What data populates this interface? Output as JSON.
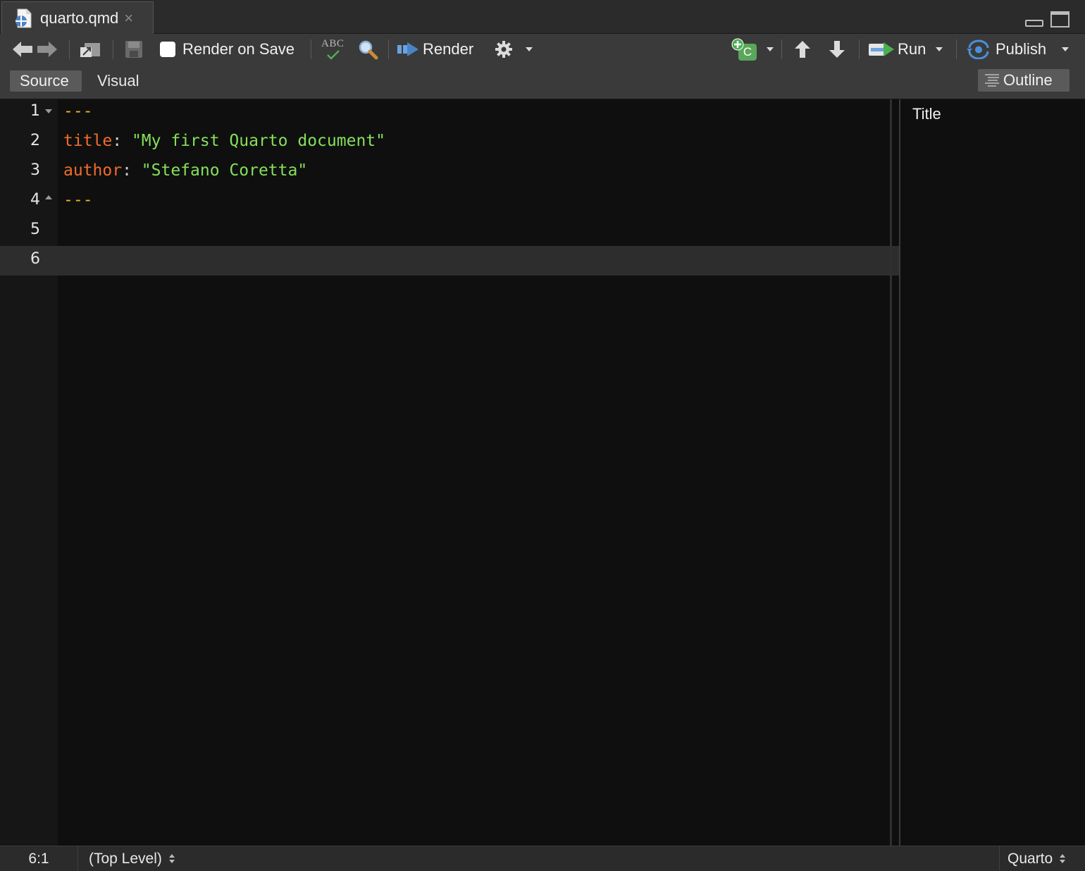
{
  "tab": {
    "filename": "quarto.qmd",
    "close_glyph": "×",
    "icon": "quarto-file-icon"
  },
  "toolbar": {
    "render_on_save_label": "Render on Save",
    "render_on_save_checked": false,
    "spellcheck_label": "ABC",
    "render_label": "Render",
    "run_label": "Run",
    "publish_label": "Publish",
    "insert_chunk_letter": "C"
  },
  "modes": {
    "source_label": "Source",
    "visual_label": "Visual",
    "active": "source"
  },
  "outline_button_label": "Outline",
  "editor": {
    "lines": [
      {
        "num": "1",
        "fold": "down",
        "tokens": [
          {
            "t": "---",
            "c": "yaml-delim"
          }
        ]
      },
      {
        "num": "2",
        "tokens": [
          {
            "t": "title",
            "c": "yaml-key"
          },
          {
            "t": ": ",
            "c": "yaml-colon"
          },
          {
            "t": "\"My first Quarto document\"",
            "c": "yaml-str"
          }
        ]
      },
      {
        "num": "3",
        "tokens": [
          {
            "t": "author",
            "c": "yaml-key"
          },
          {
            "t": ": ",
            "c": "yaml-colon"
          },
          {
            "t": "\"Stefano Coretta\"",
            "c": "yaml-str"
          }
        ]
      },
      {
        "num": "4",
        "fold": "up",
        "tokens": [
          {
            "t": "---",
            "c": "yaml-delim"
          }
        ]
      },
      {
        "num": "5",
        "tokens": []
      },
      {
        "num": "6",
        "current": true,
        "tokens": []
      }
    ]
  },
  "outline": {
    "items": [
      "Title"
    ]
  },
  "status": {
    "cursor": "6:1",
    "scope": "(Top Level)",
    "language": "Quarto"
  },
  "colors": {
    "yaml_delim": "#f0b429",
    "yaml_key": "#ef6c2d",
    "yaml_string": "#84e05a",
    "publish_blue": "#4a90d9",
    "chunk_green": "#5aa65a"
  }
}
